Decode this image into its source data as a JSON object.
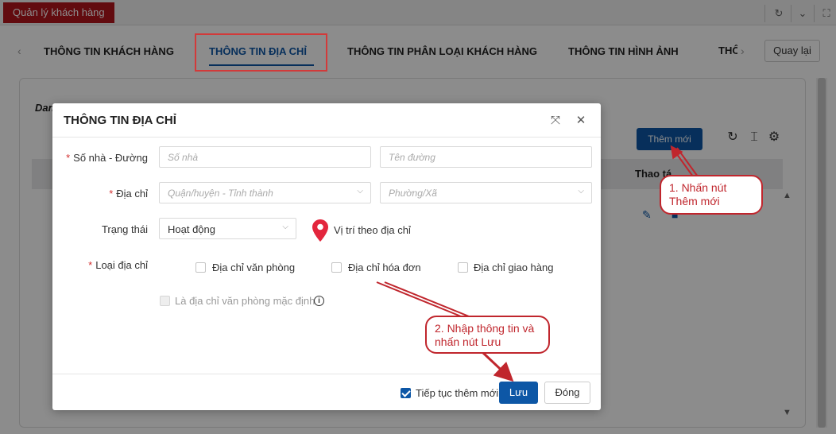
{
  "app": {
    "title": "Quản lý khách hàng"
  },
  "tabs": [
    {
      "label": "THÔNG TIN KHÁCH HÀNG"
    },
    {
      "label": "THÔNG TIN ĐỊA CHỈ"
    },
    {
      "label": "THÔNG TIN PHÂN LOẠI KHÁCH HÀNG"
    },
    {
      "label": "THÔNG TIN HÌNH ẢNH"
    },
    {
      "label": "THÔ"
    }
  ],
  "back_button": "Quay lại",
  "background": {
    "section_title": "Dan",
    "add_button": "Thêm mới",
    "column_action": "Thao tá"
  },
  "modal": {
    "title": "THÔNG TIN ĐỊA CHỈ",
    "fields": {
      "street_label": "Số nhà - Đường",
      "house_number_placeholder": "Số nhà",
      "street_name_placeholder": "Tên đường",
      "address_label": "Địa chỉ",
      "district_placeholder": "Quận/huyện - Tỉnh thành",
      "ward_placeholder": "Phường/Xã",
      "status_label": "Trạng thái",
      "status_value": "Hoạt động",
      "location_label": "Vị trí theo địa chỉ",
      "type_label": "Loại địa chỉ",
      "type_options": [
        "Địa chỉ văn phòng",
        "Địa chỉ hóa đơn",
        "Địa chỉ giao hàng"
      ],
      "default_office_label": "Là địa chỉ văn phòng mặc định"
    },
    "footer": {
      "continue_label": "Tiếp tục thêm mới",
      "continue_checked": true,
      "save_button": "Lưu",
      "close_button": "Đóng"
    }
  },
  "annotations": {
    "step1": [
      "1. Nhấn nút",
      "Thêm mới"
    ],
    "step2": [
      "2. Nhập thông tin và",
      "nhấn nút Lưu"
    ]
  },
  "colors": {
    "brand_red": "#b3141c",
    "primary_blue": "#0d57a6",
    "annotation_red": "#c0262d",
    "required_star": "#d32f2f"
  }
}
